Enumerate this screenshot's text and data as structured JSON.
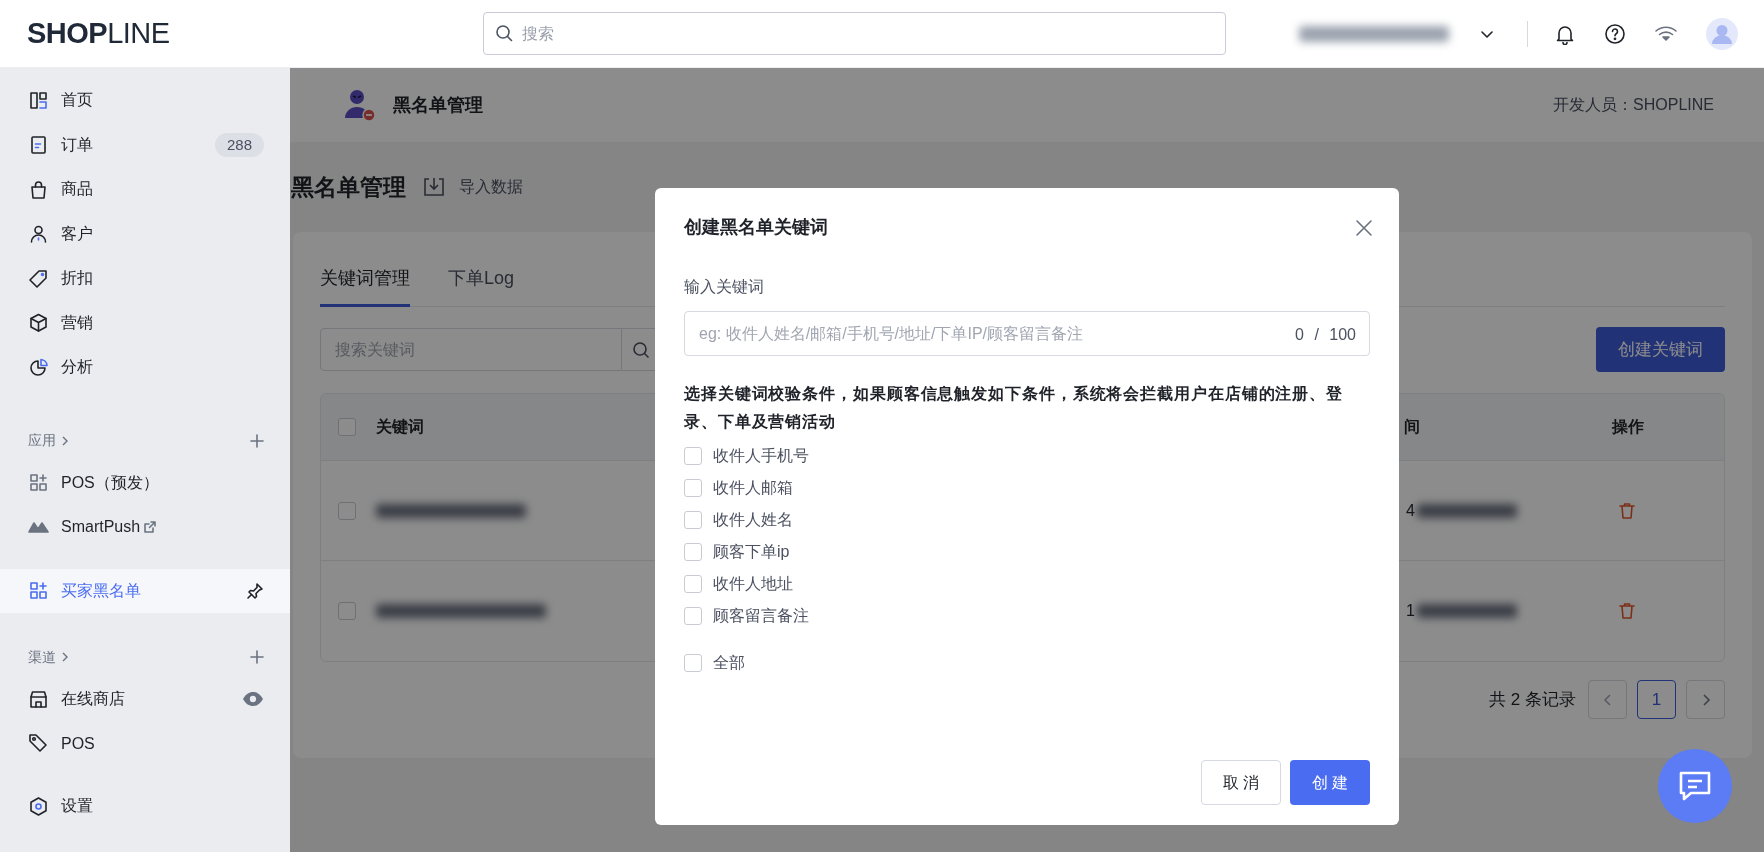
{
  "top_bar": {
    "logo": "**SHOP**LINE",
    "search_placeholder": "搜索"
  },
  "sidebar": {
    "main_items": [
      {
        "label": "首页",
        "selected": false
      },
      {
        "label": "订单",
        "badge": "288",
        "selected": false
      },
      {
        "label": "商品",
        "selected": false
      },
      {
        "label": "客户",
        "selected": false
      },
      {
        "label": "折扣",
        "selected": false
      },
      {
        "label": "营销",
        "selected": false
      },
      {
        "label": "分析",
        "selected": false
      }
    ],
    "apps": {
      "title": "应用",
      "items": [
        {
          "label": "POS（预发）",
          "selected": false
        },
        {
          "label": "SmartPush",
          "selected": false
        },
        {
          "label": "买家黑名单",
          "selected": true
        }
      ]
    },
    "channels": {
      "title": "渠道",
      "items": [
        {
          "label": "在线商店",
          "selected": false
        },
        {
          "label": "POS",
          "selected": false
        }
      ]
    },
    "settings": {
      "label": "设置",
      "selected": false
    }
  },
  "app_header": {
    "title": "黑名单管理",
    "developer": "开发人员：SHOPLINE"
  },
  "page": {
    "title": "黑名单管理",
    "import_label": "导入数据"
  },
  "tabs": [
    {
      "label": "关键词管理",
      "selected": true
    },
    {
      "label": "下单Log",
      "selected": false
    }
  ],
  "search": {
    "placeholder": "搜索关键词"
  },
  "create_button": "创建关键词",
  "table": {
    "columns": [
      "关键词",
      "间",
      "操作"
    ],
    "header_checked": false,
    "rows": [
      {
        "checked": false,
        "column_2": "4"
      },
      {
        "checked": false,
        "column_2": "1"
      }
    ]
  },
  "pagination": {
    "total": "共 2 条记录",
    "pages": [
      {
        "label": "1",
        "selected": true
      }
    ]
  },
  "modal": {
    "title": "创建黑名单关键词",
    "field_label": "输入关键词",
    "placeholder": "eg: 收件人姓名/邮箱/手机号/地址/下单IP/顾客留言备注",
    "counter": "0 / 100",
    "description": "选择关键词校验条件，如果顾客信息触发如下条件，系统将会拦截用户在店铺的注册、登录、下单及营销活动",
    "options": [
      {
        "label": "收件人手机号",
        "checked": false
      },
      {
        "label": "收件人邮箱",
        "checked": false
      },
      {
        "label": "收件人姓名",
        "checked": false
      },
      {
        "label": "顾客下单ip",
        "checked": false
      },
      {
        "label": "收件人地址",
        "checked": false
      },
      {
        "label": "顾客留言备注",
        "checked": false
      }
    ],
    "all_option": {
      "label": "全部",
      "checked": false
    },
    "cancel": "取 消",
    "confirm": "创 建"
  }
}
